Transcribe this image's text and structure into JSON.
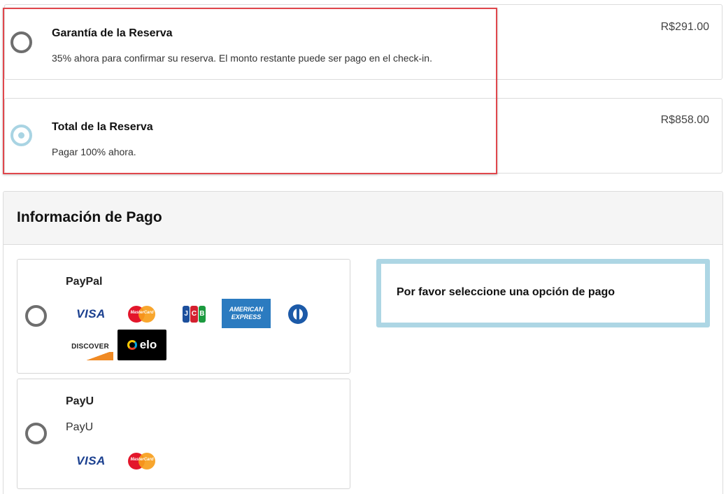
{
  "payment_options": {
    "deposit": {
      "title": "Garantía de la Reserva",
      "description": "35% ahora para confirmar su reserva. El monto restante puede ser pago en el check-in.",
      "price": "R$291.00",
      "selected": false
    },
    "full": {
      "title": "Total de la Reserva",
      "description": "Pagar 100% ahora.",
      "price": "R$858.00",
      "selected": true
    }
  },
  "payment_info": {
    "title": "Información de Pago",
    "methods": [
      {
        "name": "PayPal",
        "selected": false,
        "logos": [
          "VISA",
          "MasterCard",
          "JCB",
          "AMERICAN EXPRESS",
          "Diners Club",
          "DISCOVER",
          "elo"
        ]
      },
      {
        "name": "PayU",
        "subtitle": "PayU",
        "selected": false,
        "logos": [
          "VISA",
          "MasterCard"
        ]
      }
    ],
    "notice": "Por favor seleccione una opción de pago"
  },
  "logo_text": {
    "visa": "VISA",
    "mastercard": "MasterCard",
    "jcb": [
      "J",
      "C",
      "B"
    ],
    "amex_line1": "AMERICAN",
    "amex_line2": "EXPRESS",
    "discover": "DISCOVER",
    "elo": "elo"
  },
  "colors": {
    "highlight_border": "#e0474c",
    "radio_selected": "#a9d4e3",
    "notice_border": "#add6e4",
    "jcb": [
      "#1c4f9c",
      "#d3202f",
      "#1c9a3f"
    ]
  }
}
